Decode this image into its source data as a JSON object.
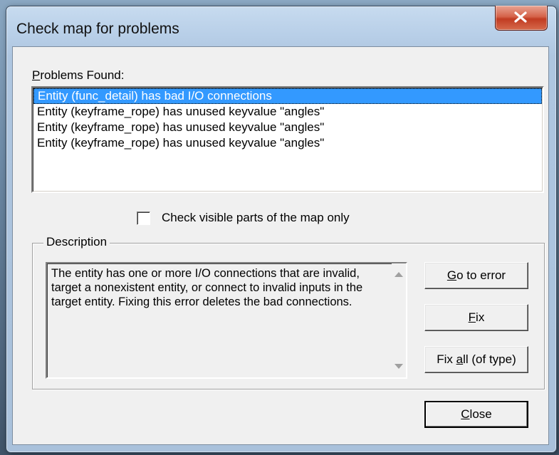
{
  "window": {
    "title": "Check map for problems"
  },
  "problems": {
    "label_accel": "P",
    "label_rest": "roblems Found:",
    "items": [
      "Entity (func_detail) has bad I/O connections",
      "Entity (keyframe_rope) has unused keyvalue \"angles\"",
      "Entity (keyframe_rope) has unused keyvalue \"angles\"",
      "Entity (keyframe_rope) has unused keyvalue \"angles\""
    ],
    "selected_index": 0
  },
  "visible_only": {
    "label": "Check visible parts of the map only",
    "checked": false
  },
  "description": {
    "group_label": "Description",
    "text": "The entity has one or more I/O connections that are invalid, target a nonexistent entity, or connect to invalid inputs in the target entity. Fixing this error deletes the bad connections."
  },
  "buttons": {
    "go_to_error": {
      "accel": "G",
      "rest": "o to error"
    },
    "fix": {
      "accel": "F",
      "rest": "ix"
    },
    "fix_all": {
      "pre": "Fix ",
      "accel": "a",
      "rest": "ll (of type)"
    },
    "close": {
      "accel": "C",
      "rest": "lose"
    }
  },
  "icons": {
    "close": "close-x-icon",
    "scroll_up": "scroll-up-arrow-icon",
    "scroll_down": "scroll-down-arrow-icon"
  }
}
